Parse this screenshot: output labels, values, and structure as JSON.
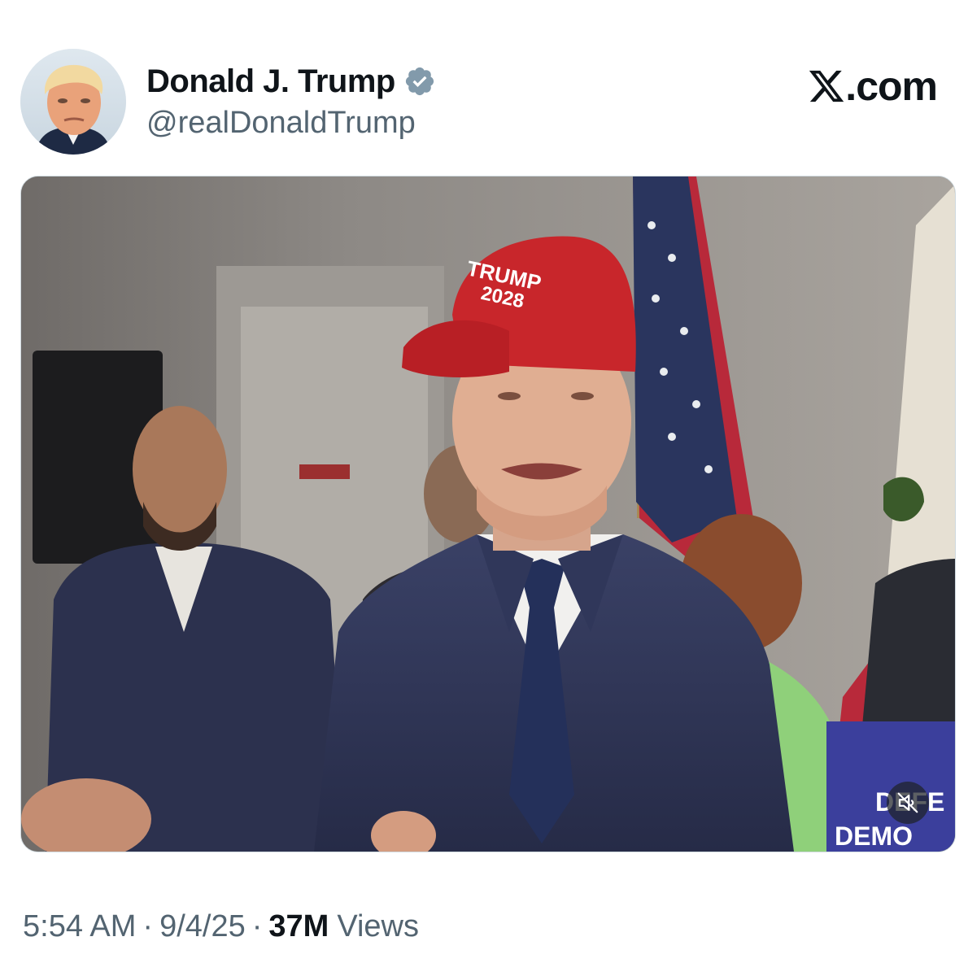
{
  "author": {
    "display_name": "Donald J. Trump",
    "handle": "@realDonaldTrump",
    "verified_icon": "verified-badge-icon",
    "verified_color": "#829aab"
  },
  "brand": {
    "logo_icon": "x-logo-icon",
    "text": ".com"
  },
  "media": {
    "type": "video",
    "hat_line1": "TRUMP",
    "hat_line2": "2028",
    "sign_text": "DEFE DEMO",
    "mute_icon": "speaker-muted-icon"
  },
  "footer": {
    "time": "5:54 AM",
    "separator": "·",
    "date": "9/4/25",
    "views_count": "37M",
    "views_label": "Views"
  },
  "colors": {
    "text_primary": "#0f1419",
    "text_secondary": "#536471",
    "hat_red": "#c8262b"
  }
}
